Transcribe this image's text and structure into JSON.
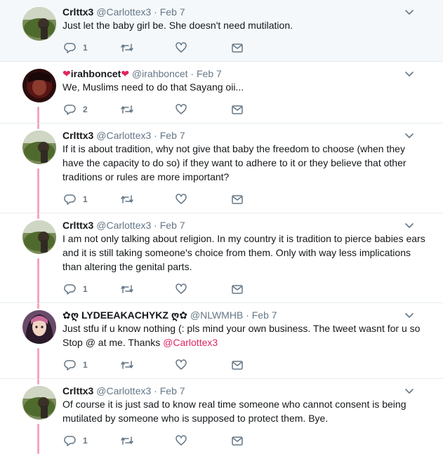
{
  "tweets": [
    {
      "name": "Crlttx3",
      "handle": "@Carlottex3",
      "dot": "·",
      "date": "Feb 7",
      "text": "Just let the baby girl be. She doesn't need mutilation.",
      "mention": "",
      "reply_count": "1"
    },
    {
      "name_prefix": "❤",
      "name": "irahboncet",
      "name_suffix": "❤",
      "handle": "@irahboncet",
      "dot": "·",
      "date": "Feb 7",
      "text": "We, Muslims need to do that Sayang oii...",
      "mention": "",
      "reply_count": "2"
    },
    {
      "name": "Crlttx3",
      "handle": "@Carlottex3",
      "dot": "·",
      "date": "Feb 7",
      "text": "If it is about tradition, why not give that baby the freedom to choose (when they have the capacity to do so) if they want to adhere to it or they believe that other traditions or rules are more important?",
      "mention": "",
      "reply_count": "1"
    },
    {
      "name": "Crlttx3",
      "handle": "@Carlottex3",
      "dot": "·",
      "date": "Feb 7",
      "text": "I am not only talking about religion. In my country it is tradition to pierce babies ears and it is still taking someone's choice from them. Only with way less implications than altering the genital parts.",
      "mention": "",
      "reply_count": "1"
    },
    {
      "name": "✿ღ LYDEEAKACHYKZ ღ✿",
      "handle": "@NLWMHB",
      "dot": "·",
      "date": "Feb 7",
      "text": "Just stfu if u know nothing (: pls mind your own business. The tweet wasnt for u so Stop @ at me. Thanks ",
      "mention": "@Carlottex3",
      "reply_count": "1"
    },
    {
      "name": "Crlttx3",
      "handle": "@Carlottex3",
      "dot": "·",
      "date": "Feb 7",
      "text": "Of course it is just sad to know real time someone who cannot consent is being mutilated by someone who is supposed to protect them. Bye.",
      "mention": "",
      "reply_count": "1"
    }
  ],
  "colors": {
    "thread_line": "#f4a6bd",
    "mention": "#e0245e",
    "muted": "#657786",
    "highlight_bg": "#f5f8fa"
  },
  "icons": [
    "reply-icon",
    "retweet-icon",
    "like-icon",
    "direct-message-icon",
    "chevron-down-icon"
  ]
}
